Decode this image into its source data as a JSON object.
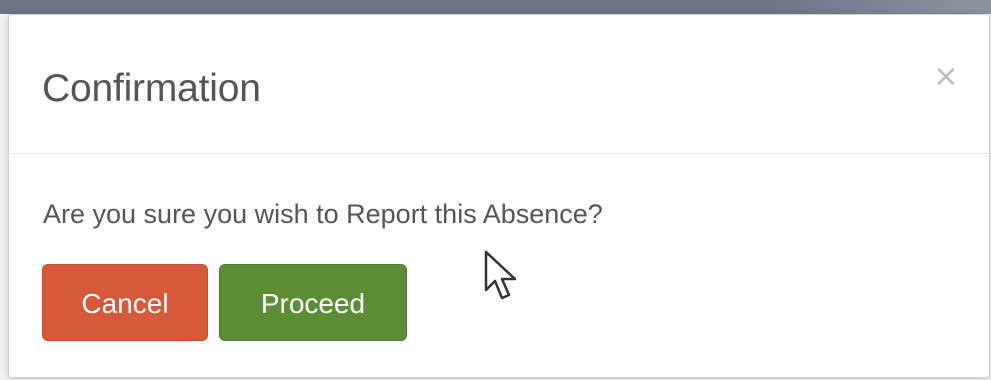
{
  "dialog": {
    "title": "Confirmation",
    "close_glyph": "×",
    "message": "Are you sure you wish to Report this Absence?",
    "cancel_label": "Cancel",
    "proceed_label": "Proceed"
  },
  "colors": {
    "cancel": "#d6593a",
    "proceed": "#5b8d35",
    "title_text": "#555555",
    "close_icon": "#bdbdbd"
  },
  "icons": {
    "close": "close-icon",
    "cursor": "mouse-pointer-icon"
  }
}
